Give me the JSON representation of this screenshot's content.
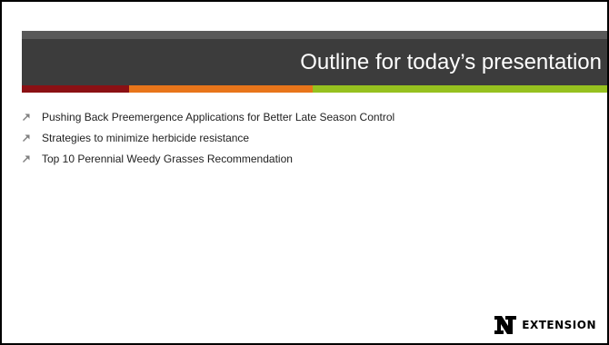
{
  "slide": {
    "title": "Outline for today’s presentation",
    "bullets": [
      {
        "text": "Pushing Back Preemergence Applications for Better Late Season Control",
        "icon": "arrow-up-right-icon"
      },
      {
        "text": "Strategies to minimize herbicide resistance",
        "icon": "arrow-up-right-icon"
      },
      {
        "text": "Top 10 Perennial Weedy Grasses Recommendation",
        "icon": "arrow-up-right-icon"
      }
    ],
    "logo": {
      "mark": "N",
      "text": "EXTENSION"
    }
  },
  "colors": {
    "title_band": "#3c3c3c",
    "accent_red": "#8b1014",
    "accent_orange": "#e8751a",
    "accent_green": "#96c11f",
    "bullet_arrow": "#7f7f7f"
  }
}
